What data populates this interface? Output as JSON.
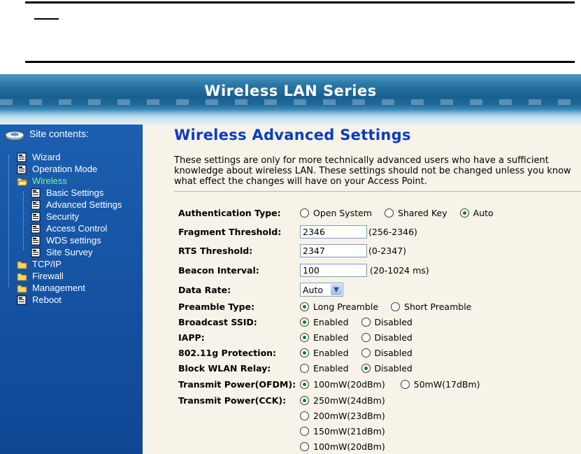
{
  "doc": {
    "note_label": ""
  },
  "banner": {
    "title": "Wireless LAN Series"
  },
  "sidebar": {
    "header": "Site contents:",
    "items": [
      {
        "label": "Wizard"
      },
      {
        "label": "Operation Mode"
      },
      {
        "label": "Wireless"
      },
      {
        "label": "Basic Settings"
      },
      {
        "label": "Advanced Settings"
      },
      {
        "label": "Security"
      },
      {
        "label": "Access Control"
      },
      {
        "label": "WDS settings"
      },
      {
        "label": "Site Survey"
      },
      {
        "label": "TCP/IP"
      },
      {
        "label": "Firewall"
      },
      {
        "label": "Management"
      },
      {
        "label": "Reboot"
      }
    ]
  },
  "main": {
    "title": "Wireless Advanced Settings",
    "description": "These settings are only for more technically advanced users who have a sufficient knowledge about wireless LAN. These settings should not be changed unless you know what effect the changes will have on your Access Point.",
    "auth": {
      "label": "Authentication Type:",
      "options": [
        "Open System",
        "Shared Key",
        "Auto"
      ],
      "selected": "Auto"
    },
    "fragment": {
      "label": "Fragment Threshold:",
      "value": "2346",
      "hint": "(256-2346)"
    },
    "rts": {
      "label": "RTS Threshold:",
      "value": "2347",
      "hint": "(0-2347)"
    },
    "beacon": {
      "label": "Beacon Interval:",
      "value": "100",
      "hint": "(20-1024 ms)"
    },
    "datarate": {
      "label": "Data Rate:",
      "value": "Auto"
    },
    "preamble": {
      "label": "Preamble Type:",
      "options": [
        "Long Preamble",
        "Short Preamble"
      ],
      "selected": "Long Preamble"
    },
    "broadcast": {
      "label": "Broadcast SSID:",
      "options": [
        "Enabled",
        "Disabled"
      ],
      "selected": "Enabled"
    },
    "iapp": {
      "label": "IAPP:",
      "options": [
        "Enabled",
        "Disabled"
      ],
      "selected": "Enabled"
    },
    "protection": {
      "label": "802.11g Protection:",
      "options": [
        "Enabled",
        "Disabled"
      ],
      "selected": "Enabled"
    },
    "relay": {
      "label": "Block WLAN Relay:",
      "options": [
        "Enabled",
        "Disabled"
      ],
      "selected": "Disabled"
    },
    "ofdm": {
      "label": "Transmit Power(OFDM):",
      "options": [
        "100mW(20dBm)",
        "50mW(17dBm)"
      ],
      "selected": "100mW(20dBm)"
    },
    "cck": {
      "label": "Transmit Power(CCK):",
      "options": [
        "250mW(24dBm)",
        "200mW(23dBm)",
        "150mW(21dBm)",
        "100mW(20dBm)"
      ],
      "selected": "250mW(24dBm)"
    }
  },
  "colors": {
    "title_blue": "#0a3bc4",
    "sidebar_blue": "#1552a2",
    "active_green": "#7bff6b",
    "content_bg": "#f7f3e8"
  }
}
